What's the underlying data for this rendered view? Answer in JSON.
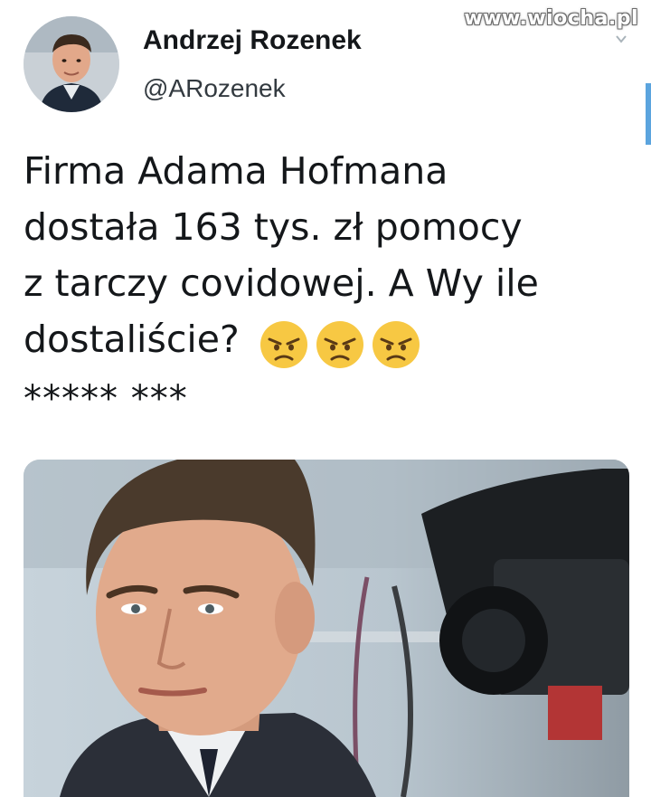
{
  "watermark": "www.wiocha.pl",
  "author": {
    "display_name": "Andrzej Rozenek",
    "handle": "@ARozenek"
  },
  "tweet": {
    "lines": [
      "Firma Adama Hofmana",
      "dostała 163 tys. zł pomocy",
      "z tarczy covidowej. A Wy ile",
      "dostaliście?"
    ],
    "emojis": [
      "angry-face-emoji",
      "angry-face-emoji",
      "angry-face-emoji"
    ],
    "footer": "***** ***"
  },
  "icons": {
    "menu": "chevron-down-icon"
  },
  "colors": {
    "accent": "#5ba4de",
    "text": "#14171a",
    "emoji_face": "#f7c843"
  }
}
